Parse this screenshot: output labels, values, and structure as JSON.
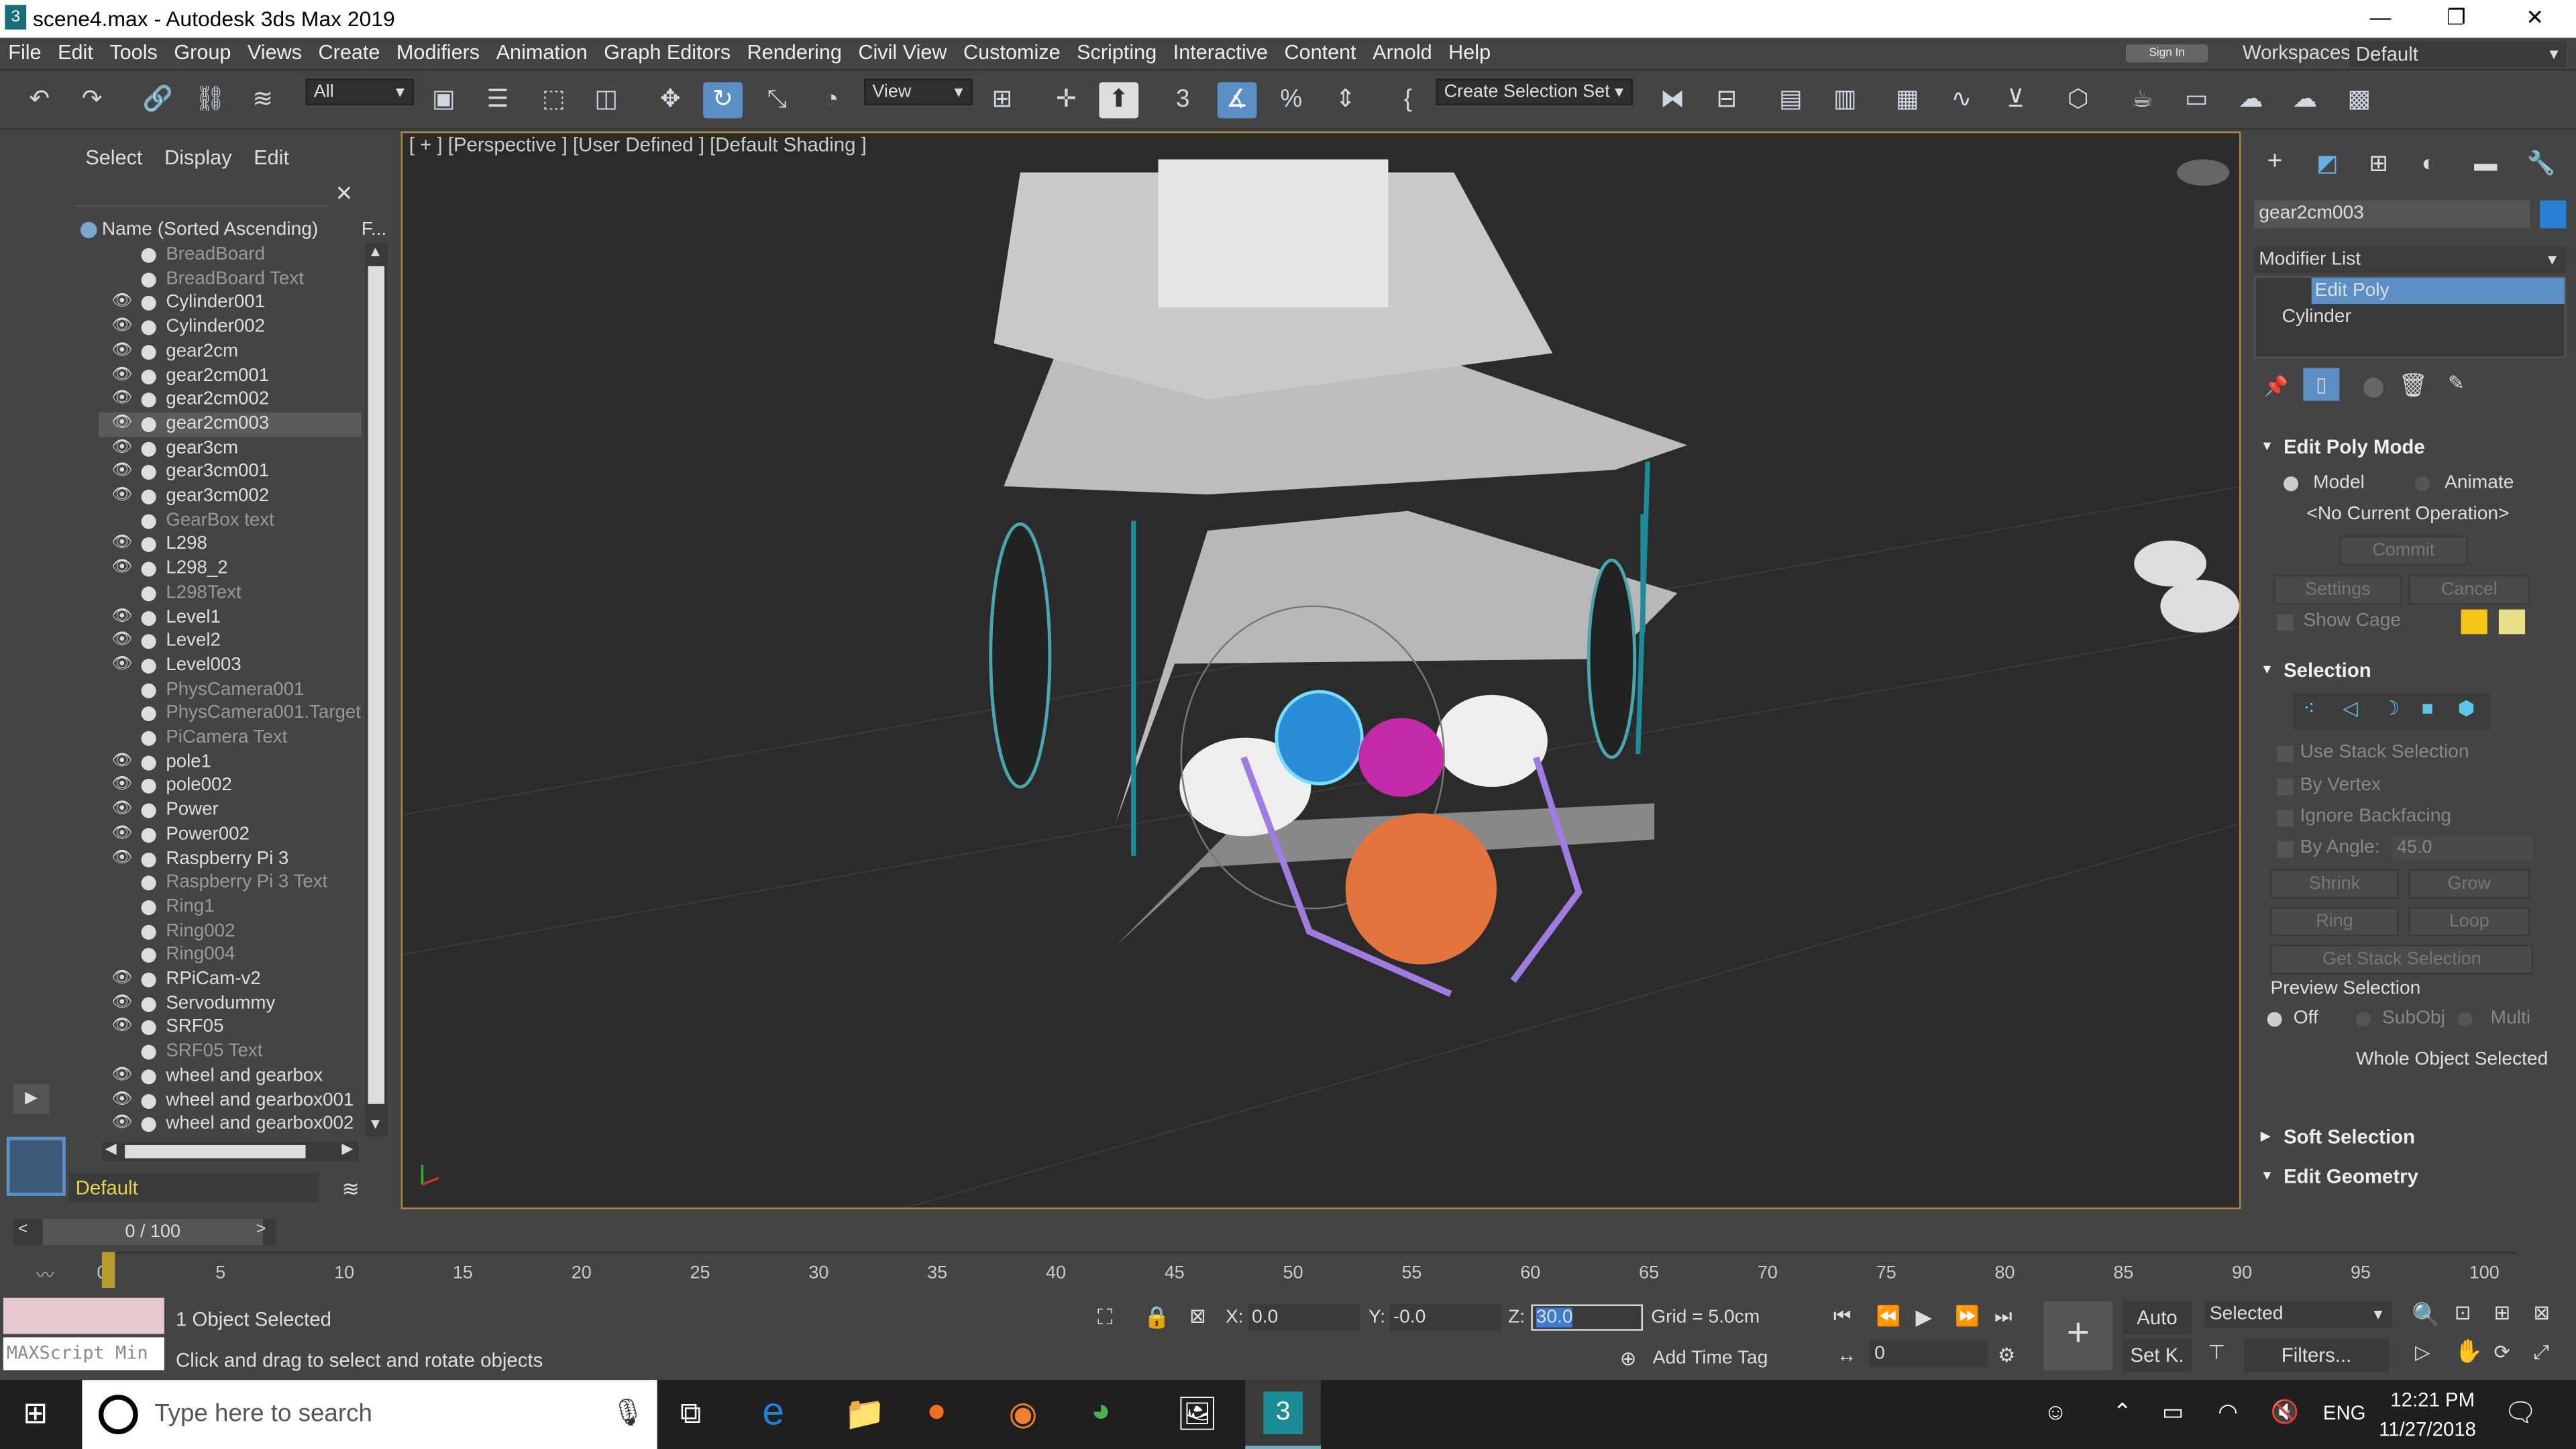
{
  "window": {
    "title": "scene4.max - Autodesk 3ds Max 2019",
    "minimize_icon": "minimize-icon",
    "maximize_icon": "maximize-icon",
    "close_icon": "close-icon"
  },
  "menu": [
    "File",
    "Edit",
    "Tools",
    "Group",
    "Views",
    "Create",
    "Modifiers",
    "Animation",
    "Graph Editors",
    "Rendering",
    "Civil View",
    "Customize",
    "Scripting",
    "Interactive",
    "Content",
    "Arnold",
    "Help"
  ],
  "workspace": {
    "label": "Workspaces:",
    "value": "Default",
    "signin": "Sign In"
  },
  "toolbar": {
    "filter_value": "All",
    "refcoord_value": "View",
    "selection_set": "Create Selection Set",
    "snaps_value": "3"
  },
  "explorer": {
    "tabs": [
      "Select",
      "Display",
      "Edit"
    ],
    "column_header": "Name (Sorted Ascending)",
    "column_header2": "F...",
    "rows": [
      {
        "name": "BreadBoard",
        "dim": true
      },
      {
        "name": "BreadBoard Text",
        "dim": true
      },
      {
        "name": "Cylinder001",
        "dim": false
      },
      {
        "name": "Cylinder002",
        "dim": false
      },
      {
        "name": "gear2cm",
        "dim": false
      },
      {
        "name": "gear2cm001",
        "dim": false
      },
      {
        "name": "gear2cm002",
        "dim": false
      },
      {
        "name": "gear2cm003",
        "dim": false,
        "selected": true
      },
      {
        "name": "gear3cm",
        "dim": false
      },
      {
        "name": "gear3cm001",
        "dim": false
      },
      {
        "name": "gear3cm002",
        "dim": false
      },
      {
        "name": "GearBox text",
        "dim": true
      },
      {
        "name": "L298",
        "dim": false
      },
      {
        "name": "L298_2",
        "dim": false
      },
      {
        "name": "L298Text",
        "dim": true
      },
      {
        "name": "Level1",
        "dim": false
      },
      {
        "name": "Level2",
        "dim": false
      },
      {
        "name": "Level003",
        "dim": false
      },
      {
        "name": "PhysCamera001",
        "dim": true
      },
      {
        "name": "PhysCamera001.Target",
        "dim": true
      },
      {
        "name": "PiCamera Text",
        "dim": true
      },
      {
        "name": "pole1",
        "dim": false
      },
      {
        "name": "pole002",
        "dim": false
      },
      {
        "name": "Power",
        "dim": false
      },
      {
        "name": "Power002",
        "dim": false
      },
      {
        "name": "Raspberry Pi 3",
        "dim": false
      },
      {
        "name": "Raspberry Pi 3 Text",
        "dim": true
      },
      {
        "name": "Ring1",
        "dim": true
      },
      {
        "name": "Ring002",
        "dim": true
      },
      {
        "name": "Ring004",
        "dim": true
      },
      {
        "name": "RPiCam-v2",
        "dim": false
      },
      {
        "name": "Servodummy",
        "dim": false
      },
      {
        "name": "SRF05",
        "dim": false
      },
      {
        "name": "SRF05 Text",
        "dim": true
      },
      {
        "name": "wheel and gearbox",
        "dim": false
      },
      {
        "name": "wheel and gearbox001",
        "dim": false
      },
      {
        "name": "wheel and gearbox002",
        "dim": false
      }
    ],
    "layer": "Default"
  },
  "viewport": {
    "label": "[ + ] [Perspective ]  [User Defined ]  [Default Shading ]"
  },
  "cmdpanel": {
    "object_name": "gear2cm003",
    "modifier_list": "Modifier List",
    "stack": [
      "Edit Poly",
      "Cylinder"
    ],
    "edit_poly_mode": "Edit Poly Mode",
    "model": "Model",
    "animate": "Animate",
    "no_op": "<No Current Operation>",
    "commit": "Commit",
    "settings": "Settings",
    "cancel": "Cancel",
    "show_cage": "Show Cage",
    "selection": "Selection",
    "use_stack": "Use Stack Selection",
    "by_vertex": "By Vertex",
    "ignore_backfacing": "Ignore Backfacing",
    "by_angle": "By Angle:",
    "angle_value": "45.0",
    "shrink": "Shrink",
    "grow": "Grow",
    "ring": "Ring",
    "loop": "Loop",
    "get_stack": "Get Stack Selection",
    "preview_selection": "Preview Selection",
    "off": "Off",
    "subobj": "SubObj",
    "multi": "Multi",
    "whole_object": "Whole Object Selected",
    "soft_selection": "Soft Selection",
    "edit_geometry": "Edit Geometry"
  },
  "timeline": {
    "frame": "0 / 100",
    "ticks": [
      "0",
      "5",
      "10",
      "15",
      "20",
      "25",
      "30",
      "35",
      "40",
      "45",
      "50",
      "55",
      "60",
      "65",
      "70",
      "75",
      "80",
      "85",
      "90",
      "95",
      "100"
    ]
  },
  "status": {
    "objects_selected": "1 Object Selected",
    "prompt": "Click and drag to select and rotate objects",
    "maxscript": "MAXScript Min",
    "x_label": "X:",
    "x_value": "0.0",
    "y_label": "Y:",
    "y_value": "-0.0",
    "z_label": "Z:",
    "z_value": "30.0",
    "grid": "Grid = 5.0cm",
    "add_time_tag": "Add Time Tag",
    "auto": "Auto",
    "setk": "Set K.",
    "key_mode": "Selected",
    "filters": "Filters...",
    "frame_value": "0"
  },
  "taskbar": {
    "search_placeholder": "Type here to search",
    "time": "12:21 PM",
    "date": "11/27/2018",
    "lang": "ENG"
  }
}
